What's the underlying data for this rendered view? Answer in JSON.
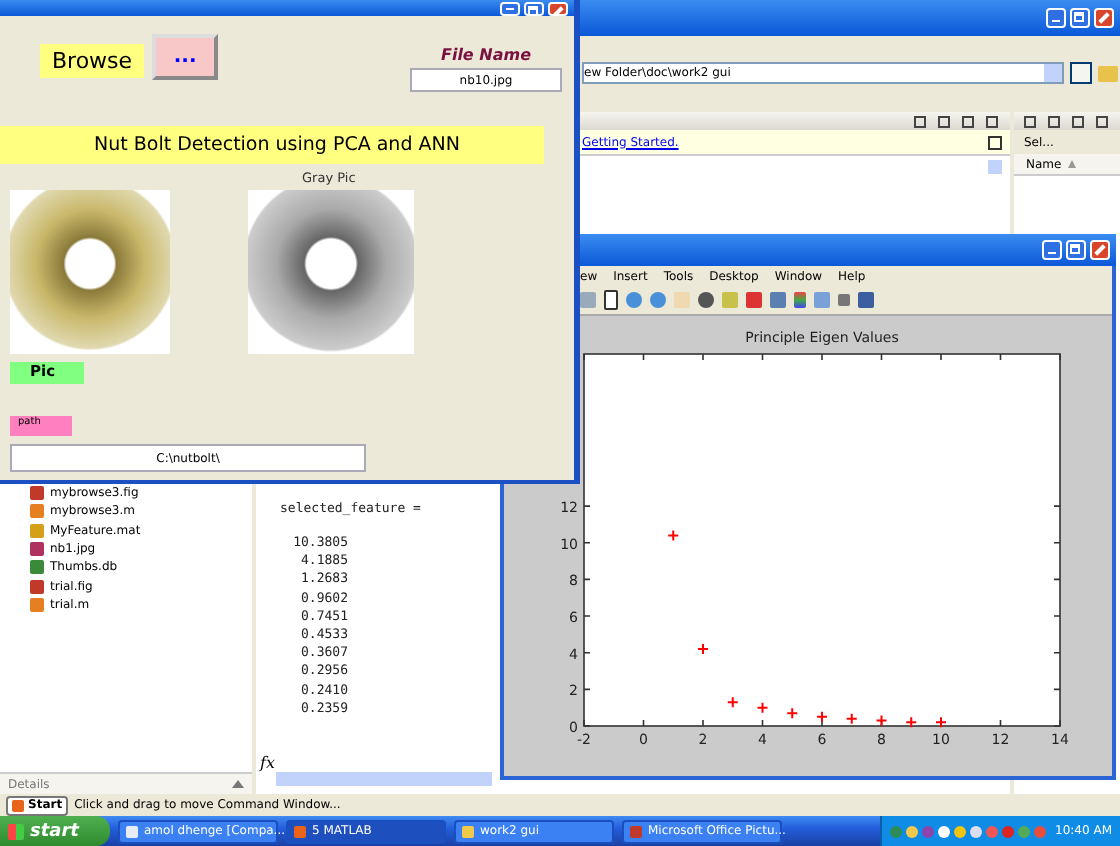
{
  "matlab_window": {
    "current_folder": "ew Folder\\doc\\work2 gui",
    "command_panel": {
      "getting_started_link": "Getting Started.",
      "variable_line": "selected_feature =",
      "values": [
        "10.3805",
        "4.1885",
        "1.2683",
        "0.9602",
        "0.7451",
        "0.4533",
        "0.3607",
        "0.2956",
        "0.2410",
        "0.2359"
      ],
      "fx": "fx"
    },
    "workspace_panel": {
      "select_button": "Sel...",
      "column": "Name"
    },
    "files": [
      {
        "name": "mybrowse3.fig",
        "kind": "fig"
      },
      {
        "name": "mybrowse3.m",
        "kind": "m"
      },
      {
        "name": "MyFeature.mat",
        "kind": "mat"
      },
      {
        "name": "nb1.jpg",
        "kind": "jpg"
      },
      {
        "name": "Thumbs.db",
        "kind": "db"
      },
      {
        "name": "trial.fig",
        "kind": "fig"
      },
      {
        "name": "trial.m",
        "kind": "m"
      }
    ],
    "details_label": "Details",
    "status_bar": {
      "start_button": "Start",
      "message": "Click and drag to move Command Window..."
    }
  },
  "gui_window": {
    "browse_label": "Browse",
    "browse_button": "...",
    "file_name_label": "File Name",
    "file_name": "nb10.jpg",
    "banner": "Nut Bolt Detection using PCA and ANN",
    "gray_label": "Gray Pic",
    "pic_label": "Pic",
    "path_label": "path",
    "path": "C:\\nutbolt\\"
  },
  "figure_window": {
    "menu": [
      "ew",
      "Insert",
      "Tools",
      "Desktop",
      "Window",
      "Help"
    ],
    "chart_data": {
      "type": "scatter",
      "title": "Principle Eigen Values",
      "x": [
        1,
        2,
        3,
        4,
        5,
        6,
        7,
        8,
        9,
        10
      ],
      "series": [
        {
          "color": "#ff0000",
          "values": [
            10.4,
            4.2,
            1.3,
            1.0,
            0.7,
            0.5,
            0.4,
            0.3,
            0.2,
            0.2
          ]
        }
      ],
      "xlim": [
        -2,
        14
      ],
      "ylim": [
        0,
        20.3
      ],
      "xticks": [
        -2,
        0,
        2,
        4,
        6,
        8,
        10,
        12,
        14
      ],
      "yticks": [
        0,
        2,
        4,
        6,
        8,
        10,
        12
      ]
    }
  },
  "taskbar": {
    "start": "start",
    "tasks": [
      {
        "label": "amol dhenge [Compa...",
        "kind": "app",
        "selected": false
      },
      {
        "label": "5 MATLAB",
        "kind": "matlab",
        "selected": true
      },
      {
        "label": "work2 gui",
        "kind": "folder",
        "selected": false
      },
      {
        "label": "Microsoft Office Pictu...",
        "kind": "picture",
        "selected": false
      }
    ],
    "clock": "10:40 AM"
  }
}
